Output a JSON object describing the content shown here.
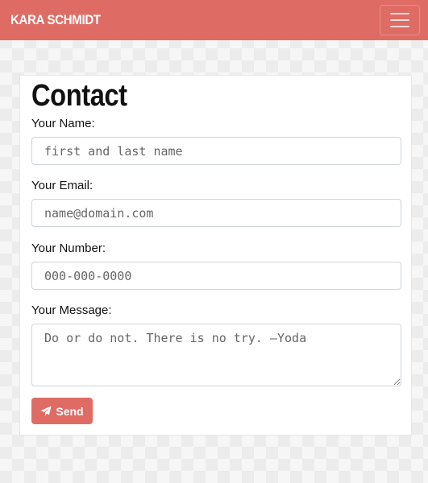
{
  "navbar": {
    "brand": "KARA SCHMIDT",
    "toggle_icon": "hamburger-menu-icon"
  },
  "contact": {
    "title": "Contact",
    "name_label": "Your Name:",
    "name_placeholder": "first and last name",
    "email_label": "Your Email:",
    "email_placeholder": "name@domain.com",
    "number_label": "Your Number:",
    "number_placeholder": "000-000-0000",
    "message_label": "Your Message:",
    "message_placeholder": "Do or do not. There is no try. —Yoda",
    "send_label": "Send",
    "send_icon": "paper-plane-icon"
  },
  "colors": {
    "accent": "#de6c65",
    "background": "#f6f6f6"
  }
}
